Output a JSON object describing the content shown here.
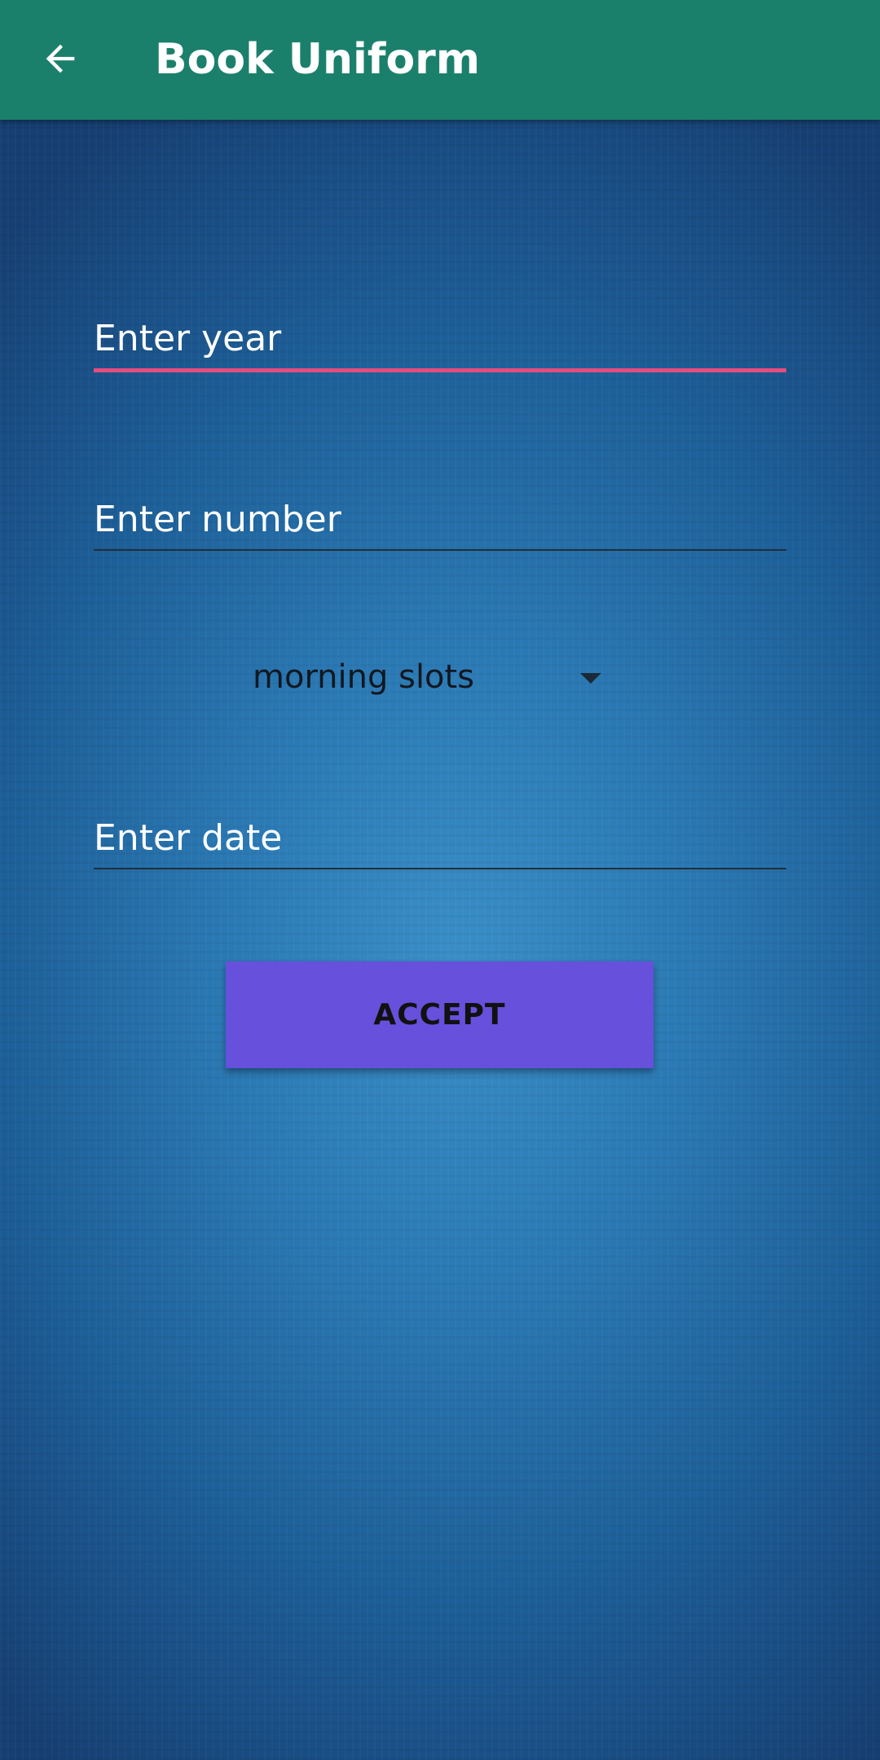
{
  "app_bar": {
    "title": "Book Uniform",
    "back_icon": "arrow-left-icon",
    "background_color": "#1b806b"
  },
  "form": {
    "year_field": {
      "placeholder": "Enter year",
      "value": "",
      "focused": true,
      "underline_color": "#e44d7d"
    },
    "number_field": {
      "placeholder": "Enter number",
      "value": ""
    },
    "slot_spinner": {
      "selected": "morning slots",
      "icon": "dropdown-triangle-icon"
    },
    "date_field": {
      "placeholder": "Enter date",
      "value": ""
    },
    "accept_button": {
      "label": "ACCEPT",
      "color": "#6750dc"
    }
  }
}
